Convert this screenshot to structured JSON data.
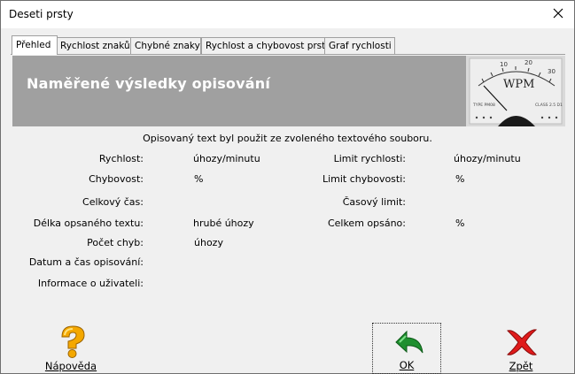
{
  "window": {
    "title": "Deseti prsty"
  },
  "tabs": [
    {
      "label": "Přehled"
    },
    {
      "label": "Rychlost znaků"
    },
    {
      "label": "Chybné znaky"
    },
    {
      "label": "Rychlost a chybovost prstů"
    },
    {
      "label": "Graf rychlosti"
    }
  ],
  "banner": {
    "title": "Naměřené výsledky opisování",
    "gauge_label": "WPM",
    "gauge_ticks": [
      "10",
      "20",
      "30"
    ],
    "gauge_type": "TYPE PM08",
    "gauge_class": "CLASS 2.5 D1"
  },
  "info_text": "Opisovaný text byl použit ze zvoleného textového souboru.",
  "left": {
    "rychlost": {
      "label": "Rychlost:",
      "value": "úhozy/minutu"
    },
    "chybovost": {
      "label": "Chybovost:",
      "value": "%"
    },
    "celkovy_cas": {
      "label": "Celkový čas:",
      "value": ""
    },
    "delka": {
      "label": "Délka opsaného textu:",
      "value": "hrubé úhozy"
    },
    "pocet_chyb": {
      "label": "Počet chyb:",
      "value": "úhozy"
    },
    "datum": {
      "label": "Datum a čas opisování:",
      "value": ""
    },
    "informace": {
      "label": "Informace o uživateli:",
      "value": ""
    }
  },
  "right": {
    "limit_rychlosti": {
      "label": "Limit rychlosti:",
      "value": "úhozy/minutu"
    },
    "limit_chybovosti": {
      "label": "Limit chybovosti:",
      "value": "%"
    },
    "casovy_limit": {
      "label": "Časový limit:",
      "value": ""
    },
    "celkem_opsano": {
      "label": "Celkem opsáno:",
      "value": "%"
    }
  },
  "buttons": {
    "napoveda": "Nápověda",
    "ok": "OK",
    "zpet": "Zpět"
  },
  "icons": {
    "help": "question-mark-icon",
    "ok": "green-arrow-icon",
    "back": "red-x-icon"
  },
  "colors": {
    "banner": "#a0a0a0",
    "window_bg": "#f0f0f0"
  }
}
